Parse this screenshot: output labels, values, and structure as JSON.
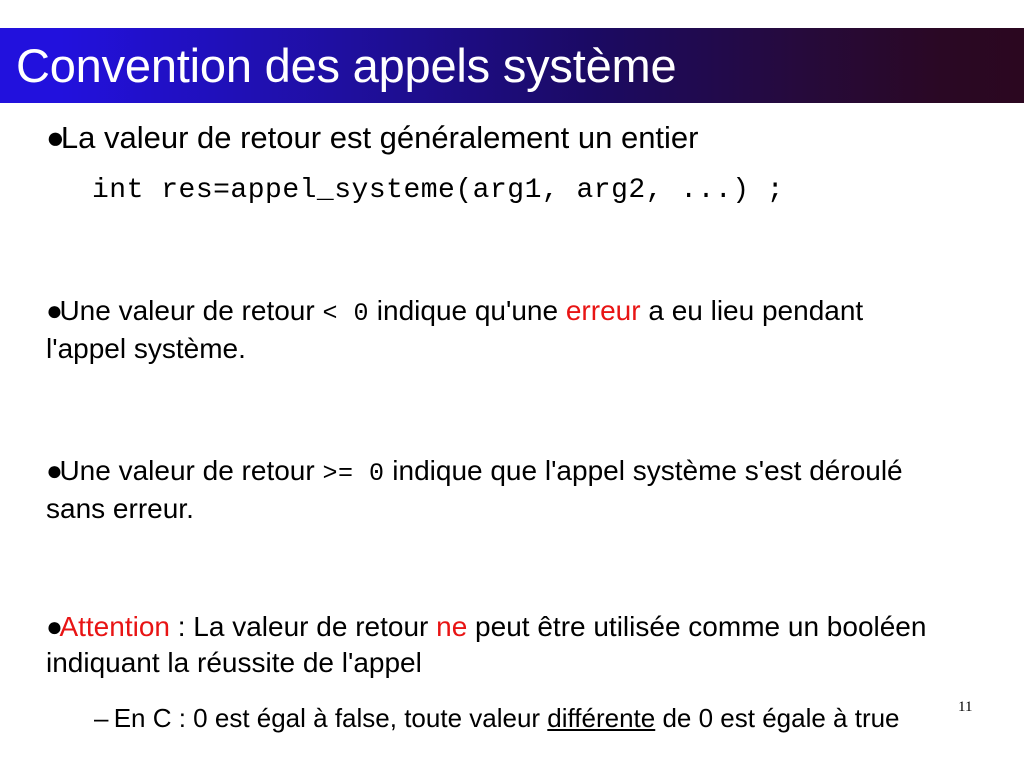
{
  "slide": {
    "title": "Convention des appels système",
    "title_colors": {
      "gradient_start": "#2211dd",
      "gradient_end": "#2b0720",
      "title_text": "#ffffff"
    },
    "background": "#ffffff",
    "accent_red": "#e81414",
    "page_number": "11",
    "bullet_marker": "●",
    "subbullet_marker": "–",
    "bullets": [
      {
        "id": "b1",
        "level": 1,
        "text": "La valeur de retour est généralement un entier"
      },
      {
        "id": "code1",
        "level": "code",
        "text": "int res=appel_systeme(arg1, arg2, ...) ;"
      },
      {
        "id": "b2",
        "level": 1,
        "part1": "Une valeur de retour",
        "code": "< 0",
        "part2": "indique qu'une",
        "highlight": "erreur",
        "part3": "a eu lieu pendant l'appel système."
      },
      {
        "id": "b3",
        "level": 1,
        "part1": "Une valeur de retour",
        "code": ">= 0",
        "part2": "indique que l'appel système s'est déroulé sans erreur."
      },
      {
        "id": "b4",
        "level": 1,
        "highlight1": "Attention",
        "part1": " : La valeur de retour ",
        "highlight2": "ne",
        "part2": " peut être utilisée comme un booléen indiquant la réussite de l'appel"
      },
      {
        "id": "b5",
        "level": 2,
        "part1": "En C : 0 est égal à false, toute valeur ",
        "underlined": "différente",
        "part2": " de 0 est égale à true"
      }
    ]
  }
}
